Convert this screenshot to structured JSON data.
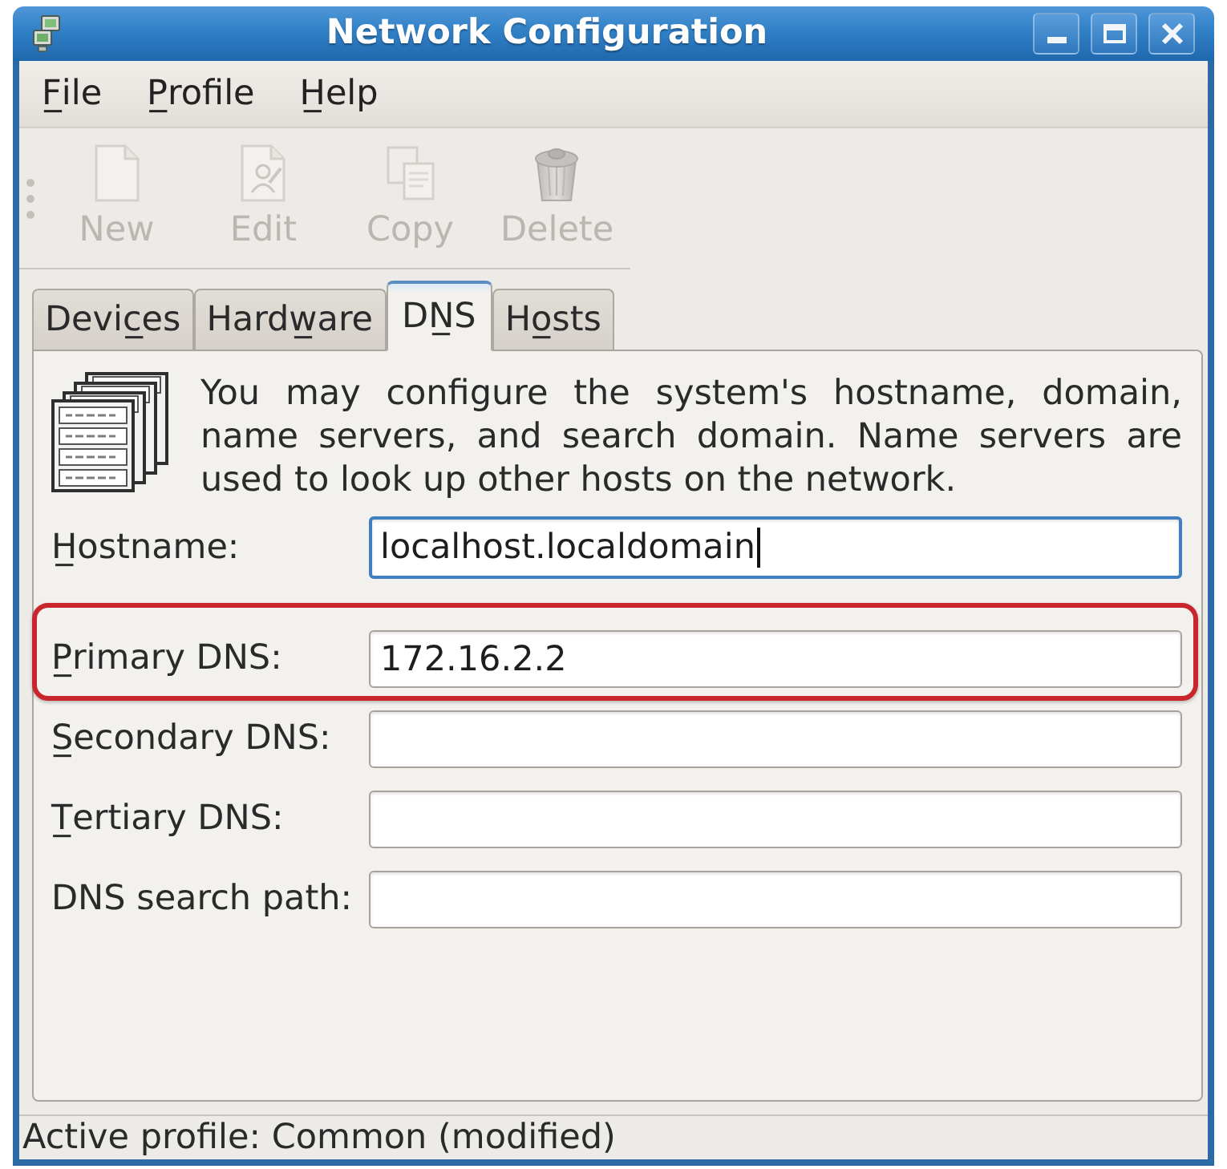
{
  "window": {
    "title": "Network Configuration"
  },
  "menu": [
    {
      "label": "F̲ile"
    },
    {
      "label": "P̲rofile"
    },
    {
      "label": "H̲elp"
    }
  ],
  "toolbar": [
    {
      "label": "New",
      "disabled": true
    },
    {
      "label": "Edit",
      "disabled": true
    },
    {
      "label": "Copy",
      "disabled": true
    },
    {
      "label": "Delete",
      "disabled": true
    }
  ],
  "tabs": [
    {
      "label": "Devic̲es",
      "selected": false
    },
    {
      "label": "Hardw̲are",
      "selected": false
    },
    {
      "label": "DN̲S",
      "selected": true
    },
    {
      "label": "Ho̲sts",
      "selected": false
    }
  ],
  "dns_page": {
    "description": "You may configure the system's hostname, domain, name servers, and search domain. Name servers are used to look up other hosts on the network.",
    "hostname": {
      "label": "H̲ostname:",
      "value": "localhost.localdomain",
      "focused": true
    },
    "dns_fields": [
      {
        "label": "P̲rimary DNS:",
        "value": "172.16.2.2",
        "focused": false,
        "highlighted": true
      },
      {
        "label": "S̲econdary DNS:",
        "focused": false,
        "highlighted": false
      },
      {
        "label": "T̲ertiary DNS:",
        "focused": false,
        "highlighted": false
      },
      {
        "label": "DNS search path:",
        "focused": false,
        "highlighted": false
      }
    ]
  },
  "status_bar": {
    "text": "Active profile: Common (modified)"
  }
}
